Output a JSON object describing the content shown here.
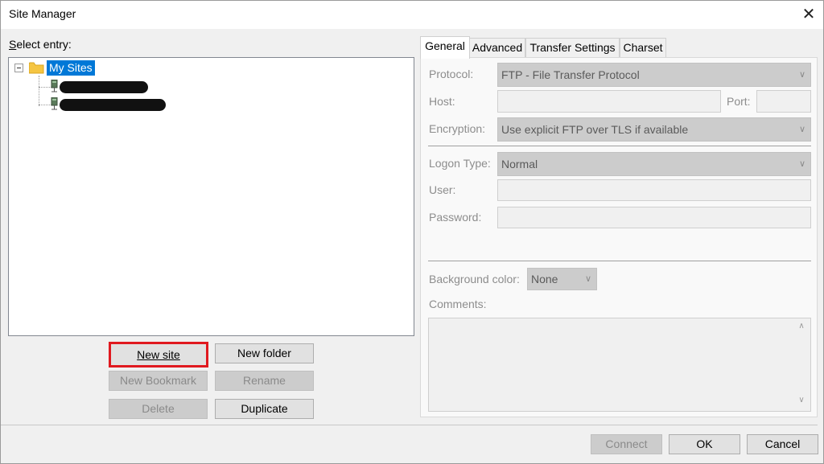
{
  "window": {
    "title": "Site Manager",
    "close_glyph": "✕"
  },
  "left": {
    "select_entry_label": "Select entry:",
    "tree": {
      "root_label": "My Sites",
      "root_expander": "⊟",
      "children_count_redacted": 2
    },
    "buttons": {
      "new_site": "New site",
      "new_folder": "New folder",
      "new_bookmark": "New Bookmark",
      "rename": "Rename",
      "delete": "Delete",
      "duplicate": "Duplicate"
    }
  },
  "tabs": [
    "General",
    "Advanced",
    "Transfer Settings",
    "Charset"
  ],
  "general": {
    "protocol_label": "Protocol:",
    "protocol_value": "FTP - File Transfer Protocol",
    "host_label": "Host:",
    "host_value": "",
    "port_label": "Port:",
    "port_value": "",
    "encryption_label": "Encryption:",
    "encryption_value": "Use explicit FTP over TLS if available",
    "logon_type_label": "Logon Type:",
    "logon_type_value": "Normal",
    "user_label": "User:",
    "user_value": "",
    "password_label": "Password:",
    "password_value": "",
    "background_color_label": "Background color:",
    "background_color_value": "None",
    "comments_label": "Comments:",
    "comments_value": ""
  },
  "footer": {
    "connect": "Connect",
    "ok": "OK",
    "cancel": "Cancel"
  },
  "colors": {
    "selection": "#0078d7",
    "highlight_border": "#e0191f",
    "folder": "#f5c542"
  }
}
